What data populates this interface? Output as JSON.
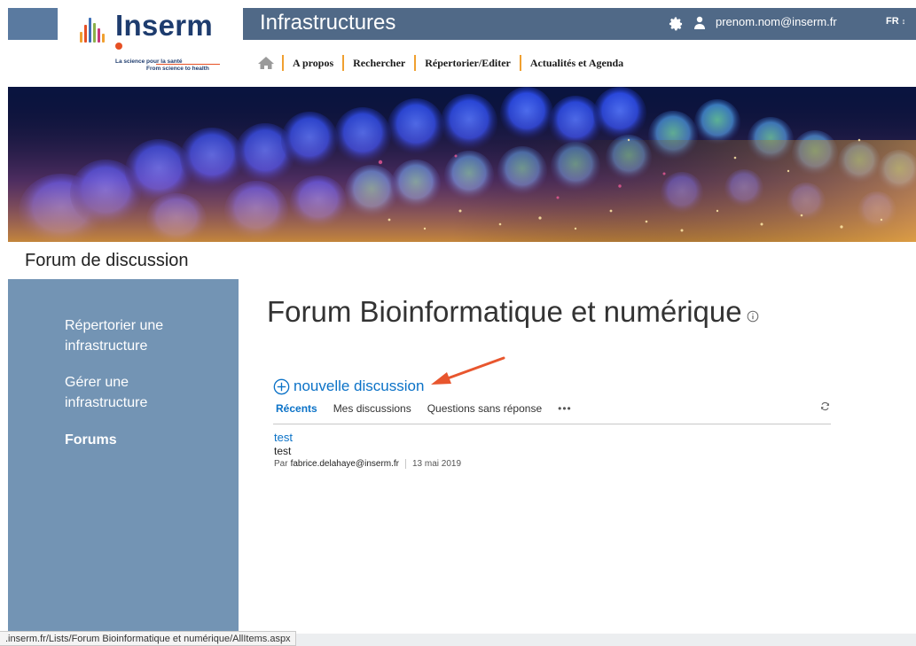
{
  "brand": {
    "name": "Inserm",
    "tagline_fr": "La science pour la santé",
    "tagline_en": "From science to health",
    "colors": {
      "navy": "#1e3c6e",
      "accent": "#e65024",
      "bars": [
        "#e65024",
        "#f0a030",
        "#3d6fb6",
        "#8bb04a",
        "#c8387a"
      ]
    }
  },
  "topbar": {
    "title": "Infrastructures",
    "settings_icon": "gear-icon",
    "user_icon": "user-icon",
    "email": "prenom.nom@inserm.fr",
    "language": "FR"
  },
  "nav": {
    "home_icon": "home-icon",
    "items": [
      "A propos",
      "Rechercher",
      "Répertorier/Editer",
      "Actualités et Agenda"
    ]
  },
  "section_title": "Forum de discussion",
  "sidebar": {
    "items": [
      {
        "label": "Répertorier une infrastructure"
      },
      {
        "label": "Gérer une infrastructure"
      },
      {
        "label": "Forums"
      }
    ]
  },
  "main": {
    "page_title": "Forum Bioinformatique et numérique",
    "new_discussion": "nouvelle discussion",
    "tabs": [
      "Récents",
      "Mes discussions",
      "Questions sans réponse"
    ],
    "more": "•••",
    "posts": [
      {
        "title": "test",
        "body": "test",
        "by_prefix": "Par",
        "author": "fabrice.delahaye@inserm.fr",
        "date": "13 mai 2019"
      }
    ]
  },
  "status_url": ".inserm.fr/Lists/Forum Bioinformatique et numérique/AllItems.aspx",
  "colors": {
    "sidebar": "#7394b4",
    "topbar": "#506987",
    "link": "#0b72c7",
    "arrow": "#e8562e"
  }
}
